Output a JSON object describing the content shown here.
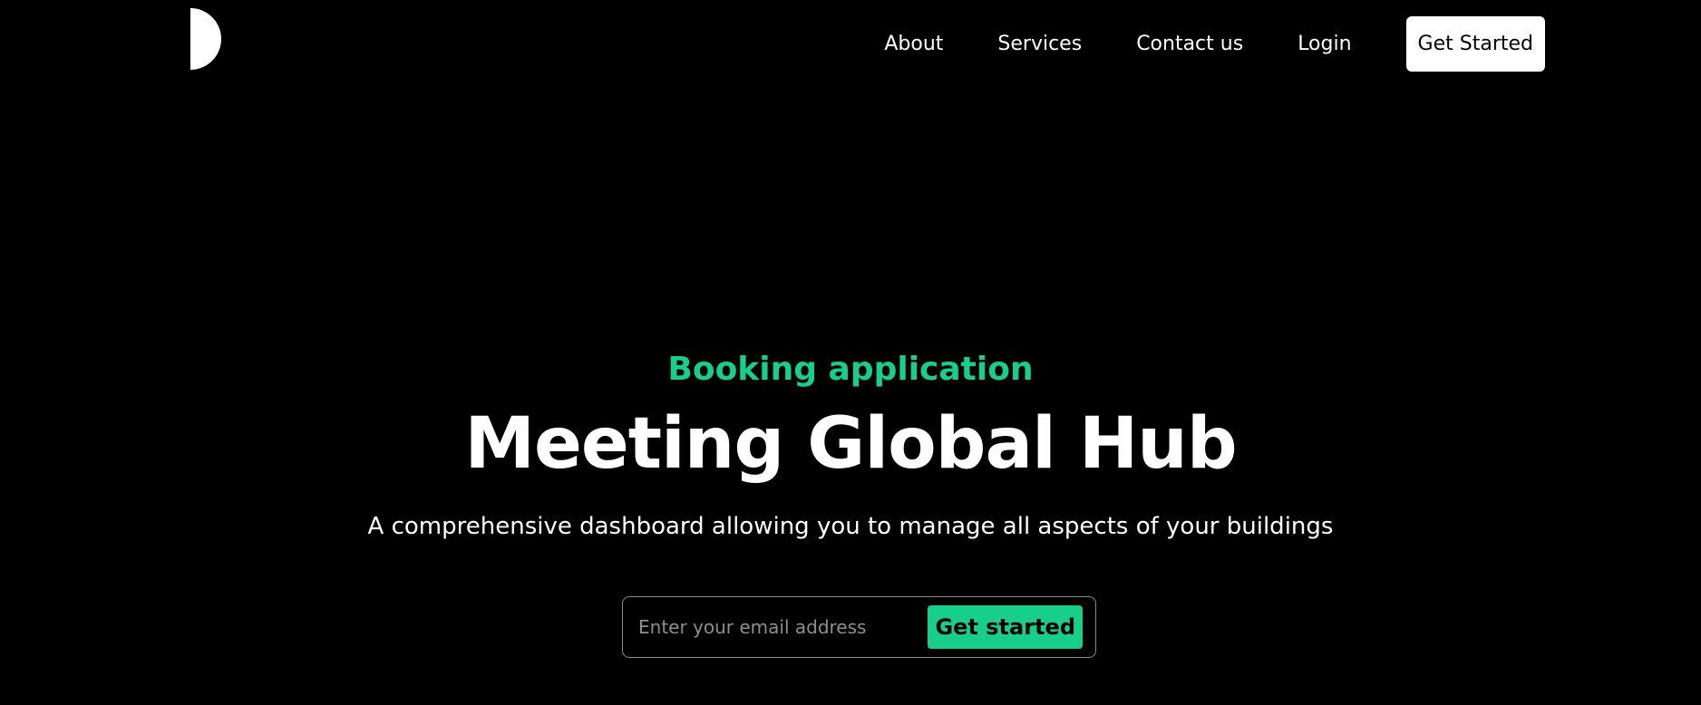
{
  "header": {
    "logo_icon": "half-circle-logo-icon",
    "nav": {
      "about": "About",
      "services": "Services",
      "contact": "Contact us",
      "login": "Login"
    },
    "cta_label": "Get Started"
  },
  "hero": {
    "eyebrow": "Booking application",
    "title": "Meeting Global Hub",
    "subtitle": "A comprehensive dashboard allowing you to manage all aspects of your buildings",
    "email_placeholder": "Enter your email address",
    "email_value": "",
    "submit_label": "Get started"
  },
  "colors": {
    "background": "#000000",
    "accent": "#17cf8b",
    "text": "#ffffff"
  }
}
